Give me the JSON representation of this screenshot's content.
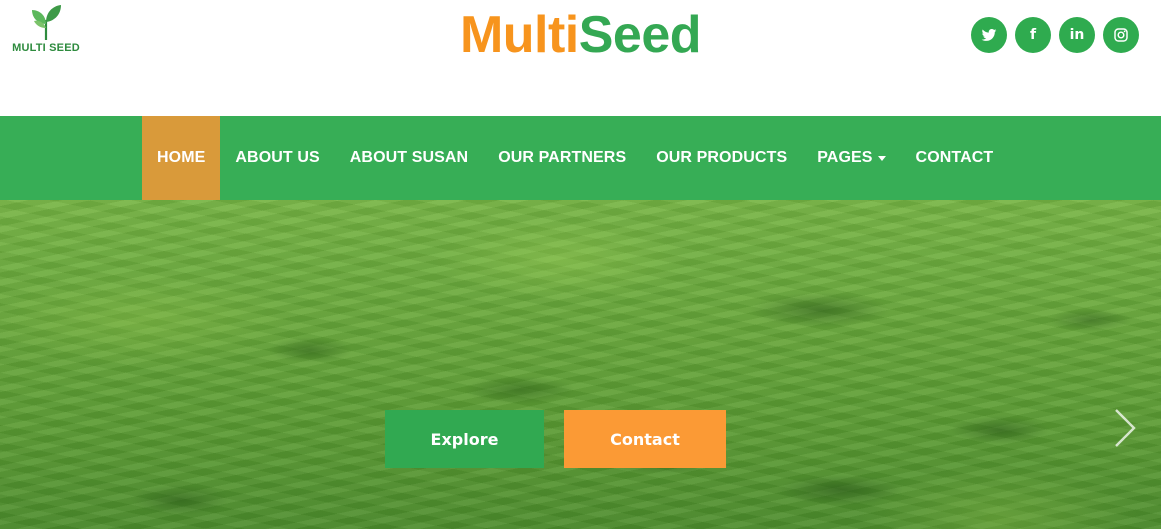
{
  "header": {
    "logo_text": "MULTI SEED",
    "brand_part1": "Multi",
    "brand_part2": "Seed",
    "socials": [
      {
        "icon": "twitter-icon"
      },
      {
        "icon": "facebook-icon",
        "glyph": "f"
      },
      {
        "icon": "linkedin-icon",
        "glyph": "in"
      },
      {
        "icon": "instagram-icon"
      }
    ]
  },
  "nav": {
    "items": [
      {
        "label": "HOME",
        "active": true
      },
      {
        "label": "ABOUT US"
      },
      {
        "label": "ABOUT SUSAN"
      },
      {
        "label": "OUR PARTNERS"
      },
      {
        "label": "OUR PRODUCTS"
      },
      {
        "label": "PAGES",
        "dropdown": true
      },
      {
        "label": "CONTACT"
      }
    ]
  },
  "hero": {
    "explore_label": "Explore",
    "contact_label": "Contact",
    "next_icon": "chevron-right-icon"
  },
  "colors": {
    "brand_orange": "#f7941d",
    "brand_green": "#34a853",
    "nav_green": "#37ae56",
    "nav_active": "#d99a3a",
    "explore_button": "#31a951",
    "contact_button": "#fb9a35"
  }
}
